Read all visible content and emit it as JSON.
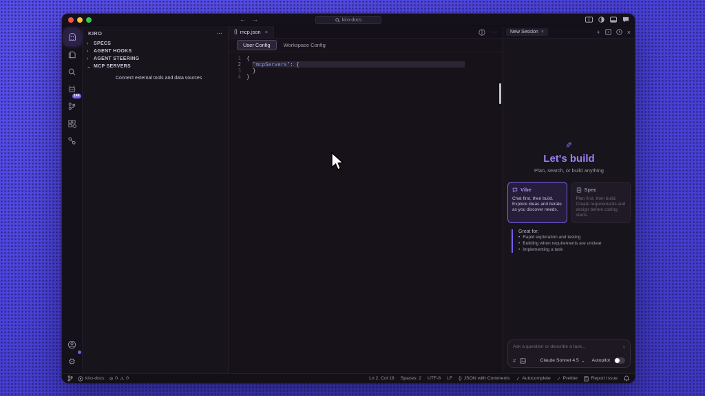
{
  "titlebar": {
    "nav_back": "←",
    "nav_forward": "→",
    "search_text": "kiro-docs"
  },
  "activity": {
    "badge": "149",
    "gear": "⚙"
  },
  "sidebar": {
    "header": "KIRO",
    "header_menu": "⋯",
    "sections": [
      {
        "chevron": "›",
        "label": "SPECS"
      },
      {
        "chevron": "›",
        "label": "AGENT HOOKS"
      },
      {
        "chevron": "›",
        "label": "AGENT STEERING"
      },
      {
        "chevron": "⌄",
        "label": "MCP SERVERS"
      }
    ],
    "mcp_empty": "Connect external tools and data sources"
  },
  "editor": {
    "tab": {
      "icon": "{}",
      "label": "mcp.json",
      "close": "×"
    },
    "more": "⋯",
    "config_tabs": [
      {
        "label": "User Config"
      },
      {
        "label": "Workspace Config"
      }
    ],
    "lines": [
      {
        "num": "1",
        "key": "",
        "rest": "{"
      },
      {
        "num": "2",
        "key": "  \"mcpServers\"",
        "rest": ": {"
      },
      {
        "num": "3",
        "key": "",
        "rest": "  }"
      },
      {
        "num": "4",
        "key": "",
        "rest": "}"
      }
    ]
  },
  "panel": {
    "tab": "New Session",
    "tab_close": "×",
    "action_new": "+",
    "action_close": "×",
    "hero": {
      "pen": "✎",
      "title": "Let's build",
      "subtitle": "Plan, search, or build anything"
    },
    "cards": [
      {
        "title": "Vibe",
        "desc": "Chat first, then build. Explore ideas and iterate as you discover needs."
      },
      {
        "title": "Spec",
        "desc": "Plan first, then build. Create requirements and design before coding starts."
      }
    ],
    "great_for": {
      "label": "Great for:",
      "items": [
        "Rapid exploration and testing",
        "Building when requirements are unclear",
        "Implementing a task"
      ]
    },
    "chat": {
      "placeholder": "Ask a question or describe a task...",
      "send": "↑",
      "context": "#",
      "model": "Claude Sonnet 4.5",
      "model_caret": "⌄",
      "autopilot": "Autopilot"
    }
  },
  "statusbar": {
    "workspace": "kiro-docs",
    "error_icon": "⊘",
    "errors": "0",
    "warning_icon": "⚠",
    "warnings": "0",
    "line_col": "Ln 2, Col 18",
    "spaces": "Spaces: 2",
    "encoding": "UTF-8",
    "eol": "LF",
    "lang_icon": "{}",
    "language": "JSON with Comments",
    "check1": "✓",
    "autocomplete": "Autocomplete",
    "check2": "✓",
    "prettier": "Prettier",
    "report": "Report Issue"
  }
}
